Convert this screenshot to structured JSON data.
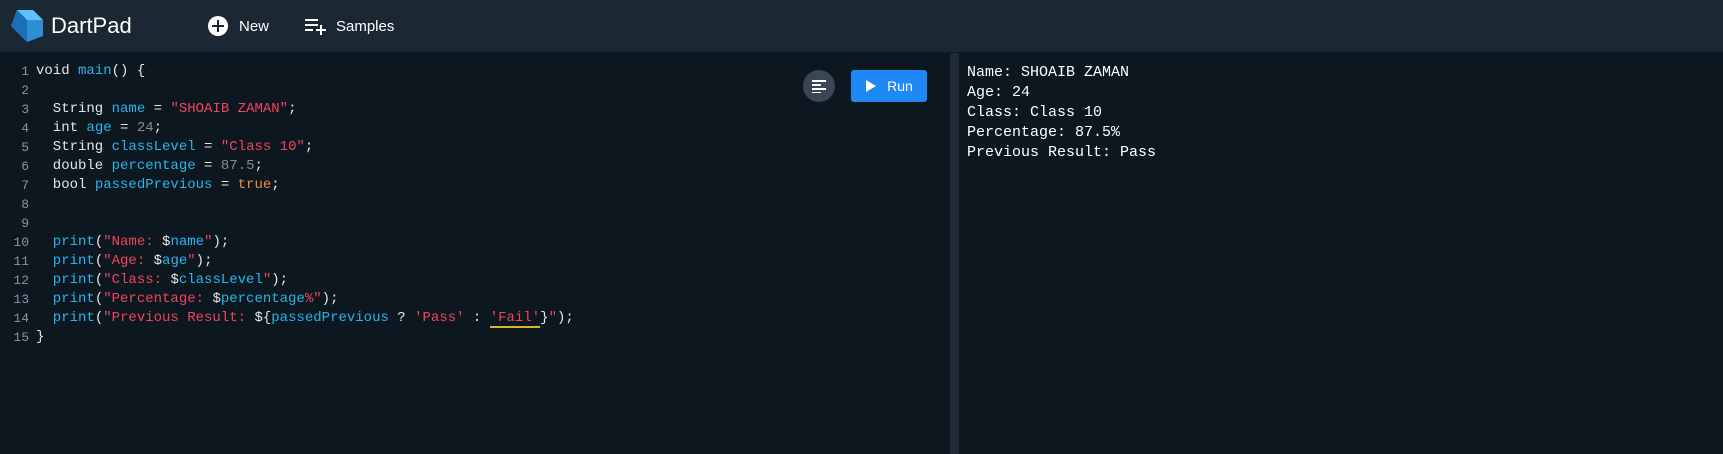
{
  "header": {
    "app_title": "DartPad",
    "new_label": "New",
    "samples_label": "Samples"
  },
  "editor": {
    "run_label": "Run",
    "lines": [
      [
        {
          "t": "void ",
          "c": "plain"
        },
        {
          "t": "main",
          "c": "ident"
        },
        {
          "t": "() {",
          "c": "plain"
        }
      ],
      [],
      [
        {
          "t": "  String ",
          "c": "plain"
        },
        {
          "t": "name",
          "c": "ident"
        },
        {
          "t": " = ",
          "c": "plain"
        },
        {
          "t": "\"SHOAIB ZAMAN\"",
          "c": "str"
        },
        {
          "t": ";",
          "c": "plain"
        }
      ],
      [
        {
          "t": "  int ",
          "c": "plain"
        },
        {
          "t": "age",
          "c": "ident"
        },
        {
          "t": " = ",
          "c": "plain"
        },
        {
          "t": "24",
          "c": "num"
        },
        {
          "t": ";",
          "c": "plain"
        }
      ],
      [
        {
          "t": "  String ",
          "c": "plain"
        },
        {
          "t": "classLevel",
          "c": "ident"
        },
        {
          "t": " = ",
          "c": "plain"
        },
        {
          "t": "\"Class 10\"",
          "c": "str"
        },
        {
          "t": ";",
          "c": "plain"
        }
      ],
      [
        {
          "t": "  double ",
          "c": "plain"
        },
        {
          "t": "percentage",
          "c": "ident"
        },
        {
          "t": " = ",
          "c": "plain"
        },
        {
          "t": "87.5",
          "c": "num"
        },
        {
          "t": ";",
          "c": "plain"
        }
      ],
      [
        {
          "t": "  bool ",
          "c": "plain"
        },
        {
          "t": "passedPrevious",
          "c": "ident"
        },
        {
          "t": " = ",
          "c": "plain"
        },
        {
          "t": "true",
          "c": "kw"
        },
        {
          "t": ";",
          "c": "plain"
        }
      ],
      [],
      [],
      [
        {
          "t": "  print",
          "c": "ident"
        },
        {
          "t": "(",
          "c": "plain"
        },
        {
          "t": "\"Name: ",
          "c": "str"
        },
        {
          "t": "$",
          "c": "plain"
        },
        {
          "t": "name",
          "c": "ident"
        },
        {
          "t": "\"",
          "c": "str"
        },
        {
          "t": ");",
          "c": "plain"
        }
      ],
      [
        {
          "t": "  print",
          "c": "ident"
        },
        {
          "t": "(",
          "c": "plain"
        },
        {
          "t": "\"Age: ",
          "c": "str"
        },
        {
          "t": "$",
          "c": "plain"
        },
        {
          "t": "age",
          "c": "ident"
        },
        {
          "t": "\"",
          "c": "str"
        },
        {
          "t": ");",
          "c": "plain"
        }
      ],
      [
        {
          "t": "  print",
          "c": "ident"
        },
        {
          "t": "(",
          "c": "plain"
        },
        {
          "t": "\"Class: ",
          "c": "str"
        },
        {
          "t": "$",
          "c": "plain"
        },
        {
          "t": "classLevel",
          "c": "ident"
        },
        {
          "t": "\"",
          "c": "str"
        },
        {
          "t": ");",
          "c": "plain"
        }
      ],
      [
        {
          "t": "  print",
          "c": "ident"
        },
        {
          "t": "(",
          "c": "plain"
        },
        {
          "t": "\"Percentage: ",
          "c": "str"
        },
        {
          "t": "$",
          "c": "plain"
        },
        {
          "t": "percentage",
          "c": "ident"
        },
        {
          "t": "%\"",
          "c": "str"
        },
        {
          "t": ");",
          "c": "plain"
        }
      ],
      [
        {
          "t": "  print",
          "c": "ident"
        },
        {
          "t": "(",
          "c": "plain"
        },
        {
          "t": "\"Previous Result: ",
          "c": "str"
        },
        {
          "t": "${",
          "c": "plain"
        },
        {
          "t": "passedPrevious",
          "c": "ident"
        },
        {
          "t": " ? ",
          "c": "plain"
        },
        {
          "t": "'Pass'",
          "c": "str"
        },
        {
          "t": " : ",
          "c": "plain"
        },
        {
          "t": "'Fail'",
          "c": "str",
          "warn": true
        },
        {
          "t": "}",
          "c": "plain"
        },
        {
          "t": "\"",
          "c": "str"
        },
        {
          "t": ");",
          "c": "plain"
        }
      ],
      [
        {
          "t": "}",
          "c": "plain"
        }
      ]
    ]
  },
  "output": {
    "lines": [
      "Name: SHOAIB ZAMAN",
      "Age: 24",
      "Class: Class 10",
      "Percentage: 87.5%",
      "Previous Result: Pass"
    ]
  },
  "colors": {
    "header_bg": "#1b2733",
    "editor_bg": "#0d1720",
    "run_button": "#1e88f5",
    "identifier": "#27b5ee",
    "string": "#f2435b",
    "number": "#8a8a8a",
    "keyword": "#f28b3a"
  },
  "icons": {
    "logo": "dart-logo-icon",
    "new": "plus-circle-icon",
    "samples": "playlist-add-icon",
    "format": "format-align-icon",
    "run": "play-icon"
  }
}
